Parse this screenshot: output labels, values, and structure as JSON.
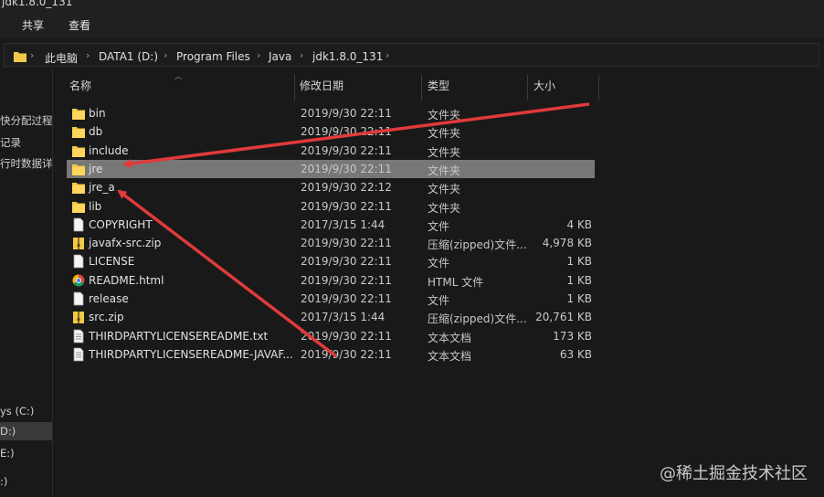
{
  "window": {
    "title": "jdk1.8.0_131"
  },
  "ribbon": {
    "tabs": [
      "共享",
      "查看"
    ]
  },
  "address": {
    "crumbs": [
      "此电脑",
      "DATA1 (D:)",
      "Program Files",
      "Java",
      "jdk1.8.0_131"
    ]
  },
  "sidebar": {
    "items": [
      "快分配过程",
      "记录",
      "行时数据详解",
      "ys (C:)",
      "D:)",
      "E:)",
      ":)"
    ]
  },
  "columns": {
    "name": "名称",
    "date": "修改日期",
    "type": "类型",
    "size": "大小"
  },
  "files": [
    {
      "name": "bin",
      "date": "2019/9/30 22:11",
      "type": "文件夹",
      "size": "",
      "icon": "folder-icon"
    },
    {
      "name": "db",
      "date": "2019/9/30 22:11",
      "type": "文件夹",
      "size": "",
      "icon": "folder-icon"
    },
    {
      "name": "include",
      "date": "2019/9/30 22:11",
      "type": "文件夹",
      "size": "",
      "icon": "folder-icon"
    },
    {
      "name": "jre",
      "date": "2019/9/30 22:11",
      "type": "文件夹",
      "size": "",
      "icon": "folder-icon",
      "selected": true
    },
    {
      "name": "jre_a",
      "date": "2019/9/30 22:12",
      "type": "文件夹",
      "size": "",
      "icon": "folder-icon"
    },
    {
      "name": "lib",
      "date": "2019/9/30 22:11",
      "type": "文件夹",
      "size": "",
      "icon": "folder-icon"
    },
    {
      "name": "COPYRIGHT",
      "date": "2017/3/15 1:44",
      "type": "文件",
      "size": "4 KB",
      "icon": "file-icon"
    },
    {
      "name": "javafx-src.zip",
      "date": "2019/9/30 22:11",
      "type": "压缩(zipped)文件...",
      "size": "4,978 KB",
      "icon": "zip-icon"
    },
    {
      "name": "LICENSE",
      "date": "2019/9/30 22:11",
      "type": "文件",
      "size": "1 KB",
      "icon": "file-icon"
    },
    {
      "name": "README.html",
      "date": "2019/9/30 22:11",
      "type": "HTML 文件",
      "size": "1 KB",
      "icon": "chrome-icon"
    },
    {
      "name": "release",
      "date": "2019/9/30 22:11",
      "type": "文件",
      "size": "1 KB",
      "icon": "file-icon"
    },
    {
      "name": "src.zip",
      "date": "2017/3/15 1:44",
      "type": "压缩(zipped)文件...",
      "size": "20,761 KB",
      "icon": "zip-icon"
    },
    {
      "name": "THIRDPARTYLICENSEREADME.txt",
      "date": "2019/9/30 22:11",
      "type": "文本文档",
      "size": "173 KB",
      "icon": "text-file-icon"
    },
    {
      "name": "THIRDPARTYLICENSEREADME-JAVAF...",
      "date": "2019/9/30 22:11",
      "type": "文本文档",
      "size": "63 KB",
      "icon": "text-file-icon"
    }
  ],
  "colors": {
    "background": "#191919",
    "selection": "#777777",
    "folder": "#f3c94a",
    "arrow": "#e03a3a"
  },
  "watermark": "@稀土掘金技术社区"
}
